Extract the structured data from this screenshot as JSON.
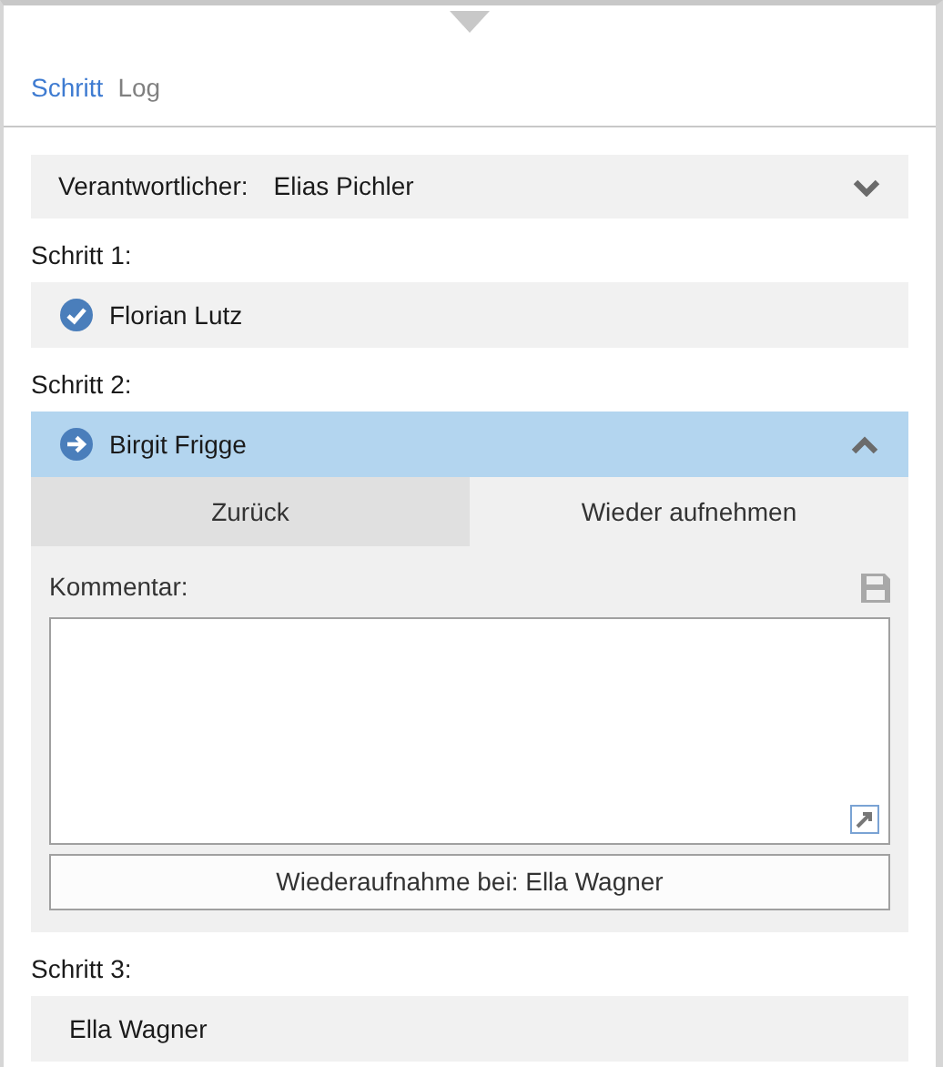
{
  "tabs": [
    {
      "label": "Schritt",
      "selected": true
    },
    {
      "label": "Log",
      "selected": false
    }
  ],
  "responsible": {
    "label": "Verantwortlicher:",
    "value": "Elias Pichler",
    "expanded": false
  },
  "steps": [
    {
      "label": "Schritt 1:",
      "name": "Florian Lutz",
      "kind": "done",
      "expanded": false
    },
    {
      "label": "Schritt 2:",
      "name": "Birgit Frigge",
      "kind": "current",
      "expanded": true,
      "actions": [
        {
          "label": "Zurück",
          "selected": false
        },
        {
          "label": "Wieder aufnehmen",
          "selected": true
        }
      ],
      "comment_label": "Kommentar:",
      "resume_button": "Wiederaufnahme bei: Ella Wagner"
    },
    {
      "label": "Schritt 3:",
      "name": "Ella Wagner",
      "kind": "pending",
      "expanded": false
    }
  ]
}
